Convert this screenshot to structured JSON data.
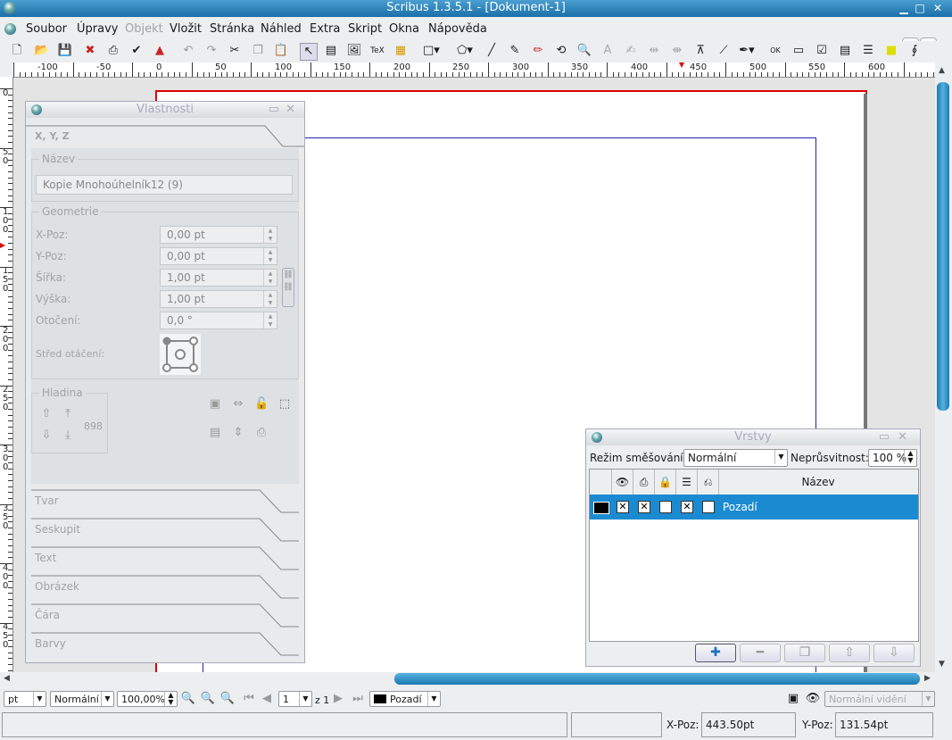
{
  "window": {
    "title": "Scribus 1.3.5.1 - [Dokument-1]"
  },
  "menu": [
    "Soubor",
    "Úpravy",
    "Objekt",
    "Vložit",
    "Stránka",
    "Náhled",
    "Extra",
    "Skript",
    "Okna",
    "Nápověda"
  ],
  "ruler": {
    "h_labels": [
      "-100",
      "-50",
      "0",
      "50",
      "100",
      "150",
      "200",
      "250",
      "300",
      "350",
      "400",
      "450",
      "500",
      "550",
      "600"
    ],
    "v_labels": [
      "0",
      "5 0",
      "1 0 0",
      "1 5 0",
      "2 0 0",
      "2 5 0",
      "3 0 0",
      "3 5 0",
      "4 0 0",
      "4 5 0"
    ]
  },
  "properties": {
    "title": "Vlastnosti",
    "tab_xyz": "X, Y, Z",
    "name_group": "Název",
    "name_value": "Kopie Mnohoúhelník12 (9)",
    "geometry_group": "Geometrie",
    "xpos_label": "X-Poz:",
    "xpos_value": "0,00 pt",
    "ypos_label": "Y-Poz:",
    "ypos_value": "0,00 pt",
    "width_label": "Šířka:",
    "width_value": "1,00 pt",
    "height_label": "Výška:",
    "height_value": "1,00 pt",
    "rotation_label": "Otočení:",
    "rotation_value": "0,0 °",
    "rotation_center_label": "Střed otáčení:",
    "level_group": "Hladina",
    "level_value": "898",
    "tabs": [
      "Tvar",
      "Seskupit",
      "Text",
      "Obrázek",
      "Čára",
      "Barvy"
    ]
  },
  "layers": {
    "title": "Vrstvy",
    "blend_label": "Režim směšování:",
    "blend_value": "Normální",
    "opacity_label": "Neprůsvitnost:",
    "opacity_value": "100 %",
    "column_name": "Název",
    "rows": [
      {
        "name": "Pozadí",
        "visible": true,
        "printable": true,
        "locked": false,
        "flow": true,
        "outline": false
      }
    ]
  },
  "zoombar": {
    "unit": "pt",
    "mode": "Normální",
    "zoom": "100,00%",
    "page": "1",
    "page_of": "z 1",
    "layer": "Pozadí",
    "view_mode": "Normální vidění"
  },
  "status": {
    "xpos_label": "X-Poz:",
    "xpos_value": "443.50pt",
    "ypos_label": "Y-Poz:",
    "ypos_value": "131.54pt"
  },
  "colors": {
    "accent": "#1b8bd1",
    "guide_red": "#dd0000",
    "margin_blue": "#2222aa"
  }
}
